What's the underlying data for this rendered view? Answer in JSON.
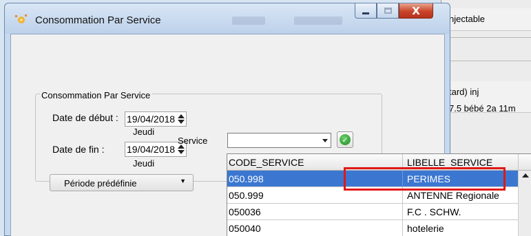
{
  "background_app": {
    "rows": [
      "njectable",
      "tard) inj",
      "7.5 bébé 2a 11m"
    ]
  },
  "window": {
    "title": "Consommation Par Service",
    "buttons": {
      "minimize": "—",
      "maximize": "☐",
      "close": "X"
    }
  },
  "form": {
    "group_title": "Consommation Par Service",
    "start_label": "Date de début :",
    "start_value": "19/04/2018",
    "start_day": "Jeudi",
    "end_label": "Date de fin :",
    "end_value": "19/04/2018",
    "end_day": "Jeudi",
    "period_button": "Période prédéfinie",
    "service_label": "Service",
    "service_value": ""
  },
  "grid": {
    "columns": [
      "CODE_SERVICE",
      "LIBELLE_SERVICE"
    ],
    "rows": [
      {
        "code": "050.998",
        "libelle": "PERIMES",
        "selected": true
      },
      {
        "code": "050.999",
        "libelle": "ANTENNE Regionale",
        "selected": false
      },
      {
        "code": "050036",
        "libelle": "F.C . SCHW.",
        "selected": false
      },
      {
        "code": "050040",
        "libelle": "hotelerie",
        "selected": false
      }
    ]
  },
  "colors": {
    "selection": "#3b77d1",
    "highlight_box": "#e01818",
    "title_bar": "#c6d9ef"
  }
}
